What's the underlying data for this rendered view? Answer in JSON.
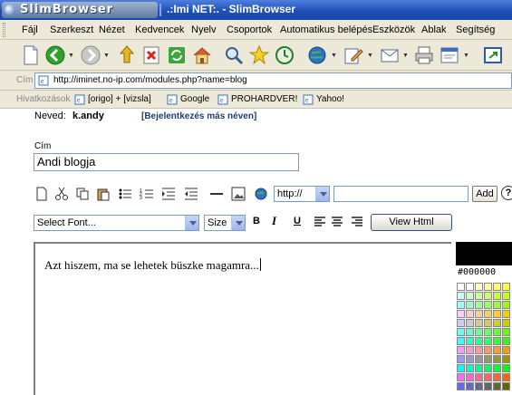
{
  "window": {
    "brand": "SlimBrowser",
    "title": ".:Imi NET:. - SlimBrowser"
  },
  "menu": [
    "Fájl",
    "Szerkeszt",
    "Nézet",
    "Kedvencek",
    "Nyelv",
    "Csoportok",
    "Automatikus belépés",
    "Eszközök",
    "Ablak",
    "Segítség"
  ],
  "address": {
    "label": "Cím",
    "url": "http://iminet.no-ip.com/modules.php?name=blog"
  },
  "links": {
    "label": "Hivatkozások",
    "items": [
      "[origo] + [vizsla]",
      "Google",
      "PROHARDVER!",
      "Yahoo!"
    ]
  },
  "page": {
    "neved_label": "Neved:",
    "username": "k.andy",
    "relogin": "[Bejelentkezés más néven]",
    "cim_label": "Cím",
    "title_value": "Andi blogja",
    "url_protocol": "http://",
    "add_label": "Add",
    "help_label": "?",
    "font_select": "Select Font...",
    "size_select": "Size",
    "bold": "B",
    "italic": "I",
    "underline": "U",
    "view_html": "View Html",
    "body_text": "Azt hiszem, ma se lehetek büszke magamra...",
    "color_hex": "#000000"
  },
  "colors": {
    "titlebar": "#1f4fb7",
    "chrome": "#ece9d8",
    "selected_color": "#000000"
  },
  "palette": [
    "#ffffff",
    "#ffffff",
    "#ffffcc",
    "#ffff99",
    "#ffff66",
    "#ffff33",
    "#ccffff",
    "#ccffcc",
    "#ccff99",
    "#ccff66",
    "#ccff33",
    "#ccff00",
    "#99ffff",
    "#99ffcc",
    "#99ff99",
    "#99ff66",
    "#99ff33",
    "#99ff00",
    "#ffccff",
    "#ffcccc",
    "#ffcc99",
    "#ffcc66",
    "#ffcc33",
    "#ffcc00",
    "#ccccff",
    "#cccccc",
    "#cccc99",
    "#cccc66",
    "#cccc33",
    "#cccc00",
    "#66ffff",
    "#66ffcc",
    "#66ff99",
    "#66ff66",
    "#66ff33",
    "#66ff00",
    "#33ffff",
    "#33ffcc",
    "#33ff99",
    "#33ff66",
    "#33ff33",
    "#33ff00",
    "#ff99ff",
    "#ff99cc",
    "#ff9999",
    "#ff9966",
    "#ff9933",
    "#ff9900",
    "#9999ff",
    "#9999cc",
    "#999999",
    "#999966",
    "#999933",
    "#999900",
    "#00ffff",
    "#00ffcc",
    "#00ff99",
    "#00ff66",
    "#00ff33",
    "#00ff00",
    "#ff66ff",
    "#ff66cc",
    "#ff6699",
    "#ff6666",
    "#ff6633",
    "#ff6600",
    "#6666ff",
    "#6666cc",
    "#666699",
    "#666666",
    "#666633",
    "#666600"
  ]
}
